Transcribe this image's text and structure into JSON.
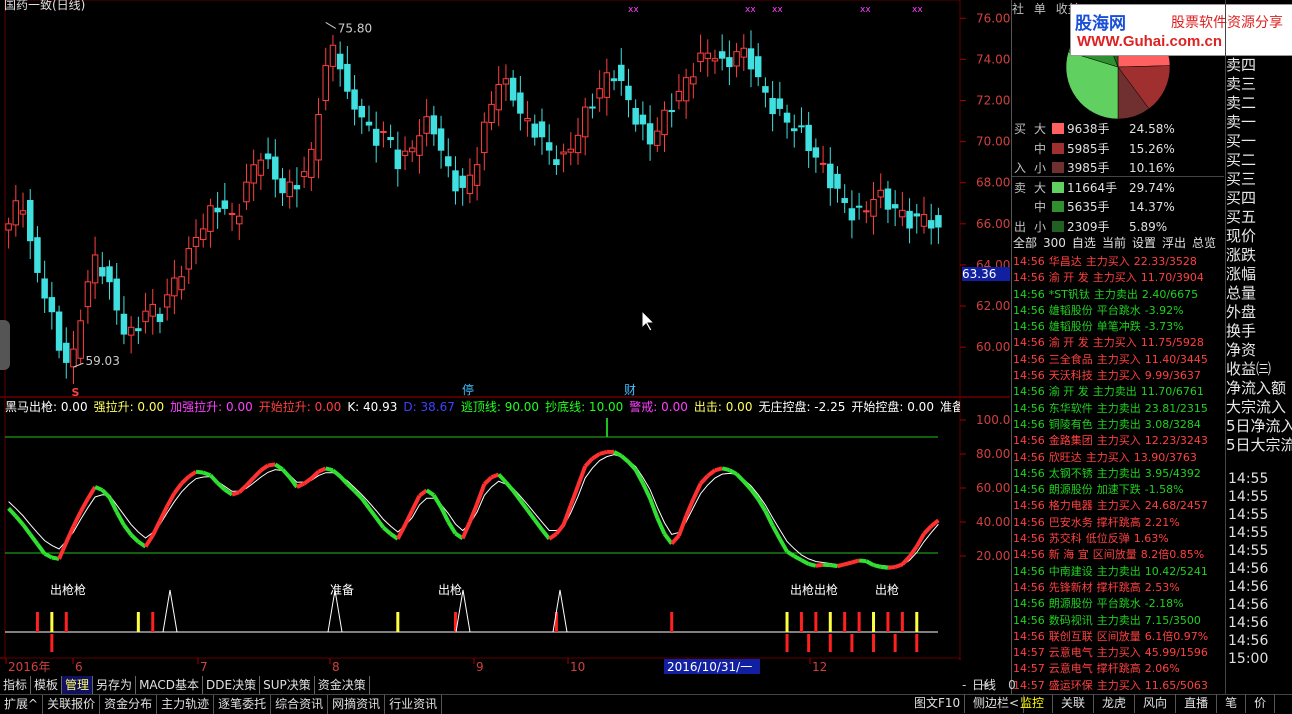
{
  "chart_title": "国药一致(日线)",
  "price_axis": {
    "ticks": [
      "76.00",
      "74.00",
      "72.00",
      "70.00",
      "68.00",
      "66.00",
      "64.00",
      "62.00",
      "60.00"
    ],
    "current": "63.36"
  },
  "annotations": {
    "high": "75.80",
    "low": "59.03",
    "tag1": "停",
    "tag2": "财",
    "s_marker": "S"
  },
  "indicator_header": [
    {
      "label": "黑马出枪",
      "value": ": 0.00",
      "color": "#ffffff"
    },
    {
      "label": "强拉升",
      "value": ": 0.00",
      "color": "#ffff60"
    },
    {
      "label": "加强拉升",
      "value": ": 0.00",
      "color": "#ff40ff"
    },
    {
      "label": "开始拉升",
      "value": ": 0.00",
      "color": "#ff4040"
    },
    {
      "label": "K",
      "value": ": 40.93",
      "color": "#ffffff"
    },
    {
      "label": "D",
      "value": ": 38.67",
      "color": "#4040ff"
    },
    {
      "label": "逃顶线",
      "value": ": 90.00",
      "color": "#20ff20"
    },
    {
      "label": "抄底线",
      "value": ": 10.00",
      "color": "#20ff20"
    },
    {
      "label": "警戒",
      "value": ": 0.00",
      "color": "#ff40ff"
    },
    {
      "label": "出击",
      "value": ": 0.00",
      "color": "#ffff60"
    },
    {
      "label": "无庄控盘",
      "value": ": -2.25",
      "color": "#ffffff"
    },
    {
      "label": "开始控盘",
      "value": ": 0.00",
      "color": "#ffffff"
    },
    {
      "label": "准备抓",
      "value": ":",
      "color": "#ffffff"
    }
  ],
  "ind_axis": {
    "ticks": [
      "100.0",
      "80.00",
      "60.00",
      "40.00",
      "20.00"
    ]
  },
  "signal_labels": [
    "出枪枪",
    "准备",
    "出枪",
    "出枪出枪",
    "出枪"
  ],
  "date_axis": {
    "labels": [
      "2016年",
      "6",
      "7",
      "8",
      "9",
      "10",
      "11",
      "12"
    ],
    "cursor": "2016/10/31/一"
  },
  "period_label": "日线",
  "ctrl": {
    "minus": "-",
    "plus": "+",
    "zero": "0"
  },
  "bottom_tabs": [
    "指标",
    "模板",
    "管理",
    "另存为",
    "MACD基本",
    "DDE决策",
    "SUP决策",
    "资金决策"
  ],
  "bottom_bar": [
    "扩展^",
    "关联报价",
    "资金分布",
    "主力轨迹",
    "逐笔委托",
    "综合资讯",
    "网摘资讯",
    "行业资讯"
  ],
  "bottom_bar_right": [
    "图文F10",
    "侧边栏<"
  ],
  "right_bottom_tabs": [
    "监控",
    "关联",
    "龙虎",
    "风向",
    "直播",
    "笔",
    "价"
  ],
  "top_tabs": [
    "社",
    "单",
    "收益"
  ],
  "logo": {
    "l1": "股海网",
    "l2": "股票软件资源分享",
    "l3": "WWW.Guhai.com.cn"
  },
  "buy_sell": [
    {
      "side": "买",
      "size": "大",
      "vol": "9638手",
      "pct": "24.58%",
      "color": "#ff6060"
    },
    {
      "side": "",
      "size": "中",
      "vol": "5985手",
      "pct": "15.26%",
      "color": "#a03030"
    },
    {
      "side": "入",
      "size": "小",
      "vol": "3985手",
      "pct": "10.16%",
      "color": "#703030"
    },
    {
      "side": "卖",
      "size": "大",
      "vol": "11664手",
      "pct": "29.74%",
      "color": "#60d060"
    },
    {
      "side": "",
      "size": "中",
      "vol": "5635手",
      "pct": "14.37%",
      "color": "#309030"
    },
    {
      "side": "出",
      "size": "小",
      "vol": "2309手",
      "pct": "5.89%",
      "color": "#206020"
    }
  ],
  "filters": [
    "全部",
    "300",
    "自选",
    "当前",
    "设置",
    "浮出",
    "总览"
  ],
  "right_col": [
    "卖四",
    "卖三",
    "卖二",
    "卖一",
    "买一",
    "买二",
    "买三",
    "买四",
    "买五",
    "现价",
    "涨跌",
    "涨幅",
    "总量",
    "外盘",
    "换手",
    "净资",
    "收益㈢",
    "净流入额",
    "大宗流入",
    "5日净流入",
    "5日大宗流"
  ],
  "times": [
    "14:55",
    "14:55",
    "14:55",
    "14:55",
    "14:55",
    "14:56",
    "14:56",
    "14:56",
    "14:56",
    "14:56",
    "15:00"
  ],
  "feed": [
    {
      "t": "14:56",
      "n": "华昌达",
      "a": "主力买入",
      "v": "22.33/3528",
      "d": "up"
    },
    {
      "t": "14:56",
      "n": "渝 开 发",
      "a": "主力买入",
      "v": "11.70/3904",
      "d": "up"
    },
    {
      "t": "14:56",
      "n": "*ST钒钛",
      "a": "主力卖出",
      "v": "2.40/6675",
      "d": "dn"
    },
    {
      "t": "14:56",
      "n": "雄韬股份",
      "a": "平台跳水",
      "v": "-3.92%",
      "d": "dn"
    },
    {
      "t": "14:56",
      "n": "雄韬股份",
      "a": "单笔冲跌",
      "v": "-3.73%",
      "d": "dn"
    },
    {
      "t": "14:56",
      "n": "渝 开 发",
      "a": "主力买入",
      "v": "11.75/5928",
      "d": "up"
    },
    {
      "t": "14:56",
      "n": "三全食品",
      "a": "主力买入",
      "v": "11.40/3445",
      "d": "up"
    },
    {
      "t": "14:56",
      "n": "天沃科技",
      "a": "主力买入",
      "v": "9.99/3637",
      "d": "up"
    },
    {
      "t": "14:56",
      "n": "渝 开 发",
      "a": "主力卖出",
      "v": "11.70/6761",
      "d": "dn"
    },
    {
      "t": "14:56",
      "n": "东华软件",
      "a": "主力卖出",
      "v": "23.81/2315",
      "d": "dn"
    },
    {
      "t": "14:56",
      "n": "铜陵有色",
      "a": "主力卖出",
      "v": "3.08/3284",
      "d": "dn"
    },
    {
      "t": "14:56",
      "n": "金路集团",
      "a": "主力买入",
      "v": "12.23/3243",
      "d": "up"
    },
    {
      "t": "14:56",
      "n": "欣旺达",
      "a": "主力买入",
      "v": "13.90/3763",
      "d": "up"
    },
    {
      "t": "14:56",
      "n": "太钢不锈",
      "a": "主力卖出",
      "v": "3.95/4392",
      "d": "dn"
    },
    {
      "t": "14:56",
      "n": "朗源股份",
      "a": "加速下跌",
      "v": "-1.58%",
      "d": "dn"
    },
    {
      "t": "14:56",
      "n": "格力电器",
      "a": "主力买入",
      "v": "24.68/2457",
      "d": "up"
    },
    {
      "t": "14:56",
      "n": "巴安水务",
      "a": "撑杆跳高",
      "v": "2.21%",
      "d": "up"
    },
    {
      "t": "14:56",
      "n": "苏交科",
      "a": "低位反弹",
      "v": "1.63%",
      "d": "up"
    },
    {
      "t": "14:56",
      "n": "新 海 宜",
      "a": "区间放量",
      "v": "8.2倍0.85%",
      "d": "up"
    },
    {
      "t": "14:56",
      "n": "中南建设",
      "a": "主力卖出",
      "v": "10.42/5241",
      "d": "dn"
    },
    {
      "t": "14:56",
      "n": "先锋新材",
      "a": "撑杆跳高",
      "v": "2.53%",
      "d": "up"
    },
    {
      "t": "14:56",
      "n": "朗源股份",
      "a": "平台跳水",
      "v": "-2.18%",
      "d": "dn"
    },
    {
      "t": "14:56",
      "n": "数码视讯",
      "a": "主力卖出",
      "v": "7.15/3500",
      "d": "dn"
    },
    {
      "t": "14:56",
      "n": "联创互联",
      "a": "区间放量",
      "v": "6.1倍0.97%",
      "d": "up"
    },
    {
      "t": "14:57",
      "n": "云意电气",
      "a": "主力买入",
      "v": "45.99/1596",
      "d": "up"
    },
    {
      "t": "14:57",
      "n": "云意电气",
      "a": "撑杆跳高",
      "v": "2.06%",
      "d": "up"
    },
    {
      "t": "14:57",
      "n": "盛运环保",
      "a": "主力买入",
      "v": "11.65/5063",
      "d": "up"
    }
  ],
  "chart_data": {
    "type": "candlestick",
    "title": "国药一致(日线)",
    "x_months": [
      "6",
      "7",
      "8",
      "9",
      "10",
      "11",
      "12"
    ],
    "ylim": [
      58.5,
      76.5
    ],
    "high_mark": 75.8,
    "low_mark": 59.03,
    "close_anchor": [
      66.0,
      67.5,
      64.0,
      62.5,
      60.0,
      59.0,
      62.5,
      64.5,
      63.0,
      61.0,
      60.5,
      62.0,
      61.5,
      63.0,
      64.0,
      65.5,
      66.5,
      67.0,
      66.0,
      68.0,
      69.5,
      68.5,
      67.5,
      68.0,
      69.0,
      73.0,
      75.0,
      72.0,
      71.5,
      70.0,
      70.5,
      69.0,
      69.5,
      71.0,
      70.5,
      68.5,
      67.5,
      68.5,
      71.0,
      73.0,
      72.5,
      71.0,
      70.5,
      69.5,
      69.0,
      70.0,
      71.5,
      72.5,
      73.5,
      72.5,
      71.0,
      70.0,
      71.0,
      72.0,
      73.0,
      74.0,
      74.5,
      73.5,
      74.5,
      74.0,
      72.5,
      71.5,
      71.0,
      70.5,
      69.5,
      68.5,
      67.5,
      66.5,
      66.5,
      67.5,
      67.0,
      66.5,
      66.0,
      66.5,
      65.5
    ],
    "k_anchor": [
      48,
      40,
      30,
      20,
      18,
      35,
      50,
      62,
      55,
      40,
      30,
      25,
      40,
      55,
      65,
      70,
      68,
      60,
      55,
      62,
      70,
      75,
      70,
      60,
      65,
      72,
      70,
      62,
      55,
      45,
      35,
      30,
      45,
      60,
      55,
      40,
      28,
      45,
      65,
      68,
      60,
      50,
      40,
      30,
      35,
      55,
      75,
      80,
      82,
      78,
      70,
      55,
      35,
      25,
      45,
      62,
      70,
      72,
      68,
      60,
      50,
      35,
      22,
      18,
      14,
      15,
      14,
      16,
      18,
      14,
      13,
      14,
      22,
      35,
      41
    ],
    "d_anchor": [
      52,
      45,
      36,
      28,
      24,
      32,
      45,
      56,
      56,
      46,
      36,
      30,
      38,
      50,
      60,
      66,
      67,
      62,
      57,
      60,
      66,
      71,
      70,
      63,
      64,
      69,
      69,
      64,
      57,
      49,
      40,
      34,
      41,
      54,
      54,
      45,
      34,
      41,
      58,
      64,
      61,
      53,
      44,
      35,
      35,
      49,
      68,
      76,
      80,
      78,
      72,
      60,
      42,
      30,
      41,
      56,
      65,
      69,
      68,
      62,
      53,
      40,
      28,
      21,
      17,
      16,
      15,
      16,
      17,
      15,
      14,
      14,
      19,
      30,
      38.67
    ],
    "guide_lines": {
      "top": 90,
      "bottom": 10
    }
  }
}
